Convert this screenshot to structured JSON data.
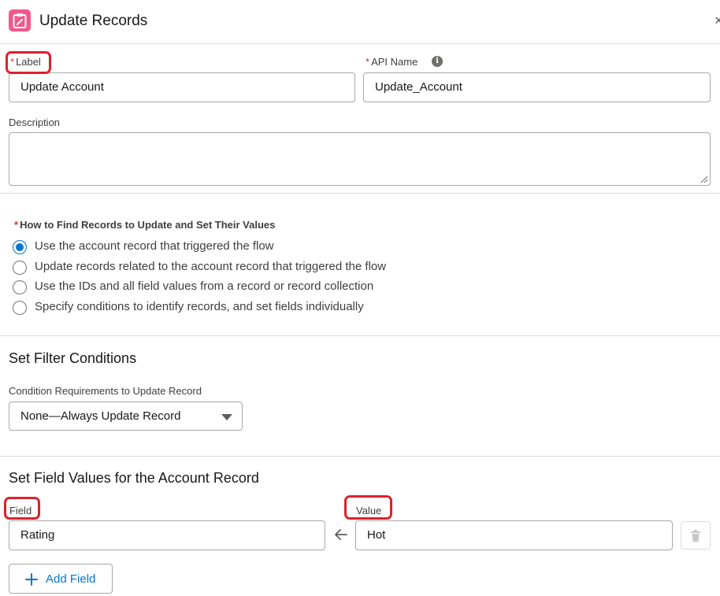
{
  "header": {
    "title": "Update Records",
    "app_icon": "clipboard-edit-icon",
    "close_label": "×"
  },
  "form": {
    "label_field": {
      "required_mark": "*",
      "label": "Label",
      "value": "Update Account"
    },
    "api_name_field": {
      "required_mark": "*",
      "label": "API Name",
      "value": "Update_Account",
      "info_icon": "i"
    },
    "description_field": {
      "label": "Description",
      "value": ""
    }
  },
  "how_to_find": {
    "required_mark": "*",
    "label": "How to Find Records to Update and Set Their Values",
    "options": [
      {
        "label": "Use the account record that triggered the flow",
        "selected": true
      },
      {
        "label": "Update records related to the account record that triggered the flow",
        "selected": false
      },
      {
        "label": "Use the IDs and all field values from a record or record collection",
        "selected": false
      },
      {
        "label": "Specify conditions to identify records, and set fields individually",
        "selected": false
      }
    ]
  },
  "filter": {
    "heading": "Set Filter Conditions",
    "condition_label": "Condition Requirements to Update Record",
    "condition_value": "None—Always Update Record"
  },
  "field_values": {
    "heading": "Set Field Values for the Account Record",
    "field_label": "Field",
    "value_label": "Value",
    "rows": [
      {
        "field": "Rating",
        "value": "Hot"
      }
    ],
    "add_button": "Add Field"
  },
  "colors": {
    "accent": "#0176d3",
    "app_icon_bg": "#f0598a",
    "required": "#c23934",
    "highlight": "#e0202a"
  }
}
